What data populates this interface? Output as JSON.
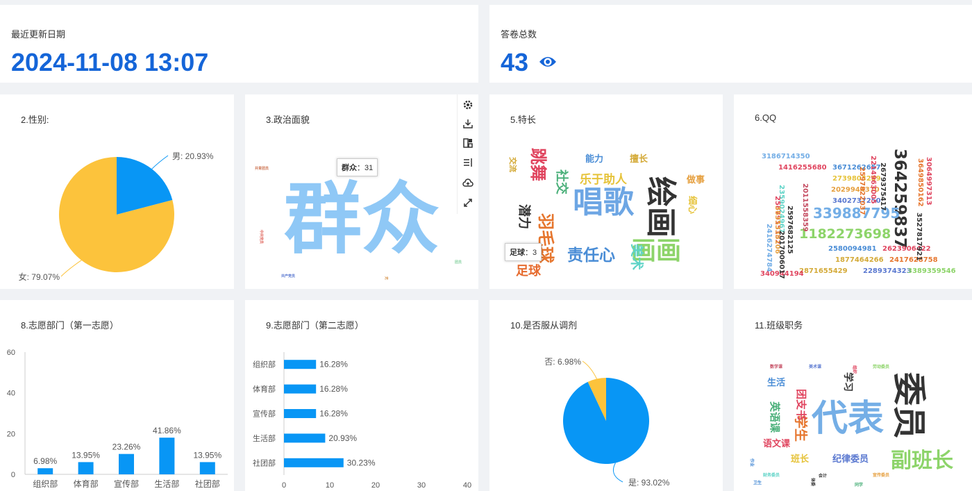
{
  "header": {
    "last_update_label": "最近更新日期",
    "last_update_value": "2024-11-08 13:07",
    "total_label": "答卷总数",
    "total_value": "43"
  },
  "colors": {
    "accent": "#1565d8",
    "blue": "#0896f5",
    "yellow": "#fcc33c"
  },
  "chart_data": [
    {
      "id": "gender",
      "type": "pie",
      "title": "2.性别:",
      "slices": [
        {
          "name": "男",
          "value": 20.93,
          "label": "男: 20.93%",
          "color": "#0896f5"
        },
        {
          "name": "女",
          "value": 79.07,
          "label": "女: 79.07%",
          "color": "#fcc33c"
        }
      ]
    },
    {
      "id": "politics",
      "type": "wordcloud",
      "title": "3.政治面貌",
      "words": [
        {
          "text": "群众",
          "value": 31
        },
        {
          "text": "共青团员",
          "value": 1
        },
        {
          "text": "中共党员",
          "value": 1
        },
        {
          "text": "共产党员",
          "value": 1
        },
        {
          "text": "团员",
          "value": 1
        },
        {
          "text": "无",
          "value": 1
        }
      ],
      "tooltip": {
        "name": "群众",
        "value": "31"
      }
    },
    {
      "id": "skills",
      "type": "wordcloud",
      "title": "5.特长",
      "words": [
        {
          "text": "唱歌",
          "value": 8
        },
        {
          "text": "绘画",
          "value": 6
        },
        {
          "text": "画画",
          "value": 5
        },
        {
          "text": "羽毛球",
          "value": 4
        },
        {
          "text": "跳舞",
          "value": 4
        },
        {
          "text": "责任心",
          "value": 4
        },
        {
          "text": "足球",
          "value": 3
        },
        {
          "text": "乐于助人",
          "value": 3
        },
        {
          "text": "美术",
          "value": 3
        },
        {
          "text": "社交",
          "value": 2
        },
        {
          "text": "潜力",
          "value": 2
        },
        {
          "text": "能力",
          "value": 2
        },
        {
          "text": "擅长",
          "value": 2
        },
        {
          "text": "做事",
          "value": 2
        },
        {
          "text": "细心",
          "value": 2
        },
        {
          "text": "交流",
          "value": 2
        }
      ],
      "tooltip": {
        "name": "足球",
        "value": "3"
      }
    },
    {
      "id": "qq",
      "type": "wordcloud",
      "title": "6.QQ",
      "words": [
        {
          "text": "364259837"
        },
        {
          "text": "339887795"
        },
        {
          "text": "1182273698"
        },
        {
          "text": "3186714350"
        },
        {
          "text": "1416255680"
        },
        {
          "text": "3671262657"
        },
        {
          "text": "2739803289"
        },
        {
          "text": "2029944370"
        },
        {
          "text": "3402737250"
        },
        {
          "text": "2580094981"
        },
        {
          "text": "2623906422"
        },
        {
          "text": "1877464266"
        },
        {
          "text": "2417628758"
        },
        {
          "text": "2871655429"
        },
        {
          "text": "2289374323"
        },
        {
          "text": "3389359546"
        },
        {
          "text": "340944194"
        },
        {
          "text": "2214963005"
        },
        {
          "text": "2679375417"
        },
        {
          "text": "3649850162"
        },
        {
          "text": "3064997313"
        },
        {
          "text": "3527817921"
        },
        {
          "text": "2011558359"
        },
        {
          "text": "2359024967"
        },
        {
          "text": "2567915152"
        },
        {
          "text": "2597682125"
        },
        {
          "text": "3635338106"
        },
        {
          "text": "2017006017"
        },
        {
          "text": "2416274784"
        },
        {
          "text": "2597822037"
        }
      ]
    },
    {
      "id": "dept1",
      "type": "bar",
      "title": "8.志愿部门（第一志愿）",
      "categories": [
        "组织部",
        "体育部",
        "宣传部",
        "生活部",
        "社团部"
      ],
      "values": [
        3,
        6,
        10,
        18,
        6
      ],
      "labels": [
        "6.98%",
        "13.95%",
        "23.26%",
        "41.86%",
        "13.95%"
      ],
      "ylim": [
        0,
        60
      ],
      "yticks": [
        0,
        20,
        40,
        60
      ]
    },
    {
      "id": "dept2",
      "type": "bar",
      "orientation": "horizontal",
      "title": "9.志愿部门（第二志愿）",
      "categories": [
        "组织部",
        "体育部",
        "宣传部",
        "生活部",
        "社团部"
      ],
      "values": [
        7,
        7,
        7,
        9,
        13
      ],
      "labels": [
        "16.28%",
        "16.28%",
        "16.28%",
        "20.93%",
        "30.23%"
      ],
      "xlim": [
        0,
        40
      ],
      "xticks": [
        0,
        10,
        20,
        30,
        40
      ]
    },
    {
      "id": "obey",
      "type": "pie",
      "title": "10.是否服从调剂",
      "slices": [
        {
          "name": "是",
          "value": 93.02,
          "label": "是: 93.02%",
          "color": "#0896f5"
        },
        {
          "name": "否",
          "value": 6.98,
          "label": "否: 6.98%",
          "color": "#fcc33c"
        }
      ]
    },
    {
      "id": "roles",
      "type": "wordcloud",
      "title": "11.班级职务",
      "words": [
        {
          "text": "代表",
          "value": 8
        },
        {
          "text": "委员",
          "value": 7
        },
        {
          "text": "副班长",
          "value": 5
        },
        {
          "text": "学生",
          "value": 3
        },
        {
          "text": "英语课",
          "value": 2
        },
        {
          "text": "团支书",
          "value": 2
        },
        {
          "text": "学习",
          "value": 2
        },
        {
          "text": "生活",
          "value": 2
        },
        {
          "text": "语文课",
          "value": 2
        },
        {
          "text": "班长",
          "value": 2
        },
        {
          "text": "纪律委员",
          "value": 2
        },
        {
          "text": "数学课",
          "value": 1
        },
        {
          "text": "美术课",
          "value": 1
        },
        {
          "text": "劳动委员",
          "value": 1
        },
        {
          "text": "组织",
          "value": 1
        },
        {
          "text": "卫生",
          "value": 1
        },
        {
          "text": "会计",
          "value": 1
        },
        {
          "text": "财务委员",
          "value": 1
        },
        {
          "text": "同学",
          "value": 1
        },
        {
          "text": "宣传委员",
          "value": 1
        },
        {
          "text": "体委",
          "value": 1
        },
        {
          "text": "作业",
          "value": 1
        }
      ]
    }
  ]
}
